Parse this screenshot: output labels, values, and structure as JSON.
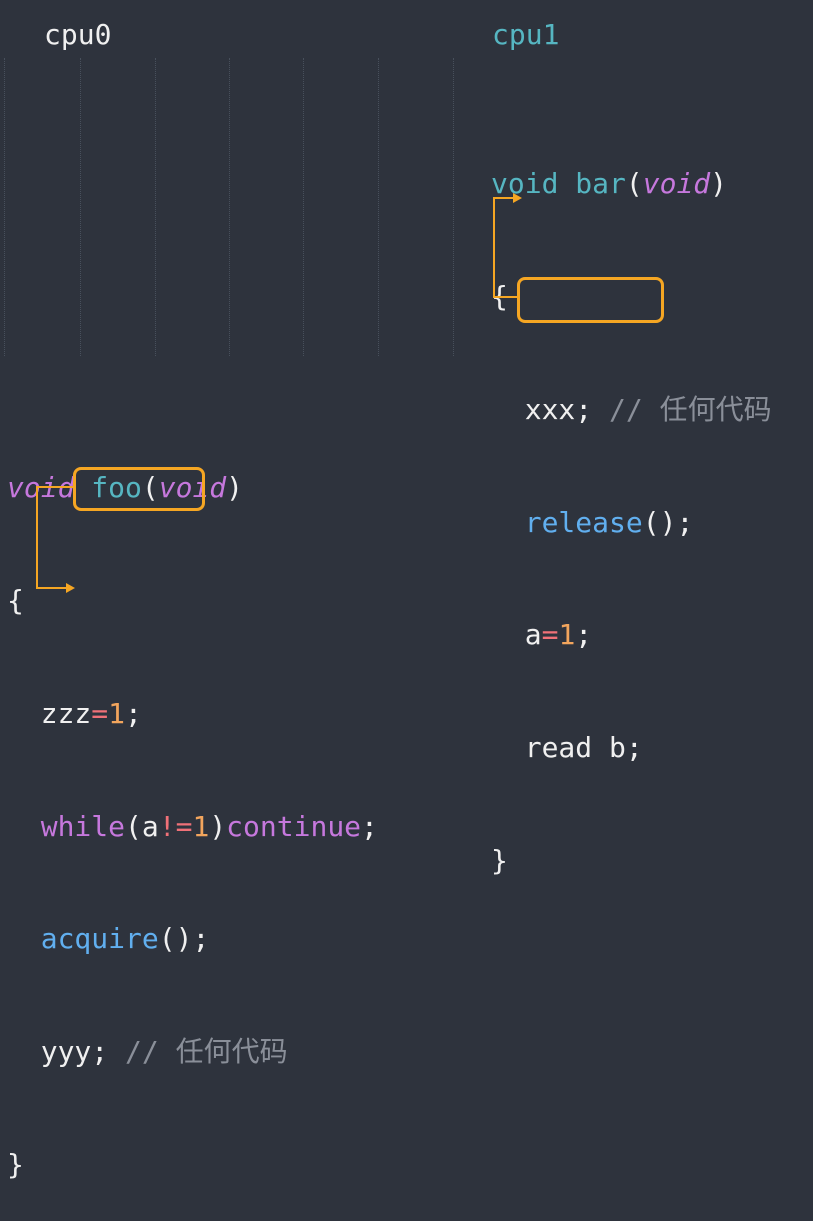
{
  "cpu0": {
    "title": "cpu0"
  },
  "cpu1": {
    "title": "cpu1",
    "lines": {
      "sig_kw": "void",
      "sig_name": "bar",
      "sig_lp": "(",
      "sig_param": "void",
      "sig_rp": ")",
      "open": "{",
      "l1_code": "xxx;",
      "l1_comment": "// 任何代码",
      "l2_call": "release",
      "l2_rest": "();",
      "l3_a": "a",
      "l3_eq": "=",
      "l3_n": "1",
      "l3_semi": ";",
      "l4": "read b;",
      "close": "}"
    }
  },
  "foo": {
    "sig_kw": "void",
    "sig_name": "foo",
    "sig_lp": "(",
    "sig_param": "void",
    "sig_rp": ")",
    "open": "{",
    "l1_z": "zzz",
    "l1_eq": "=",
    "l1_n": "1",
    "l1_semi": ";",
    "l2_kw": "while",
    "l2_lp": "(",
    "l2_a": "a",
    "l2_op": "!=",
    "l2_n": "1",
    "l2_rp": ")",
    "l2_kw2": "continue",
    "l2_semi": ";",
    "l3_call": "acquire",
    "l3_rest": "();",
    "l4_code": "yyy;",
    "l4_comment": "// 任何代码",
    "close": "}"
  },
  "colors": {
    "background": "#2e333d",
    "highlight": "#f5a623",
    "keyword": "#c678dd",
    "function": "#56b6c2",
    "call": "#61afef",
    "number": "#f2a55d"
  }
}
